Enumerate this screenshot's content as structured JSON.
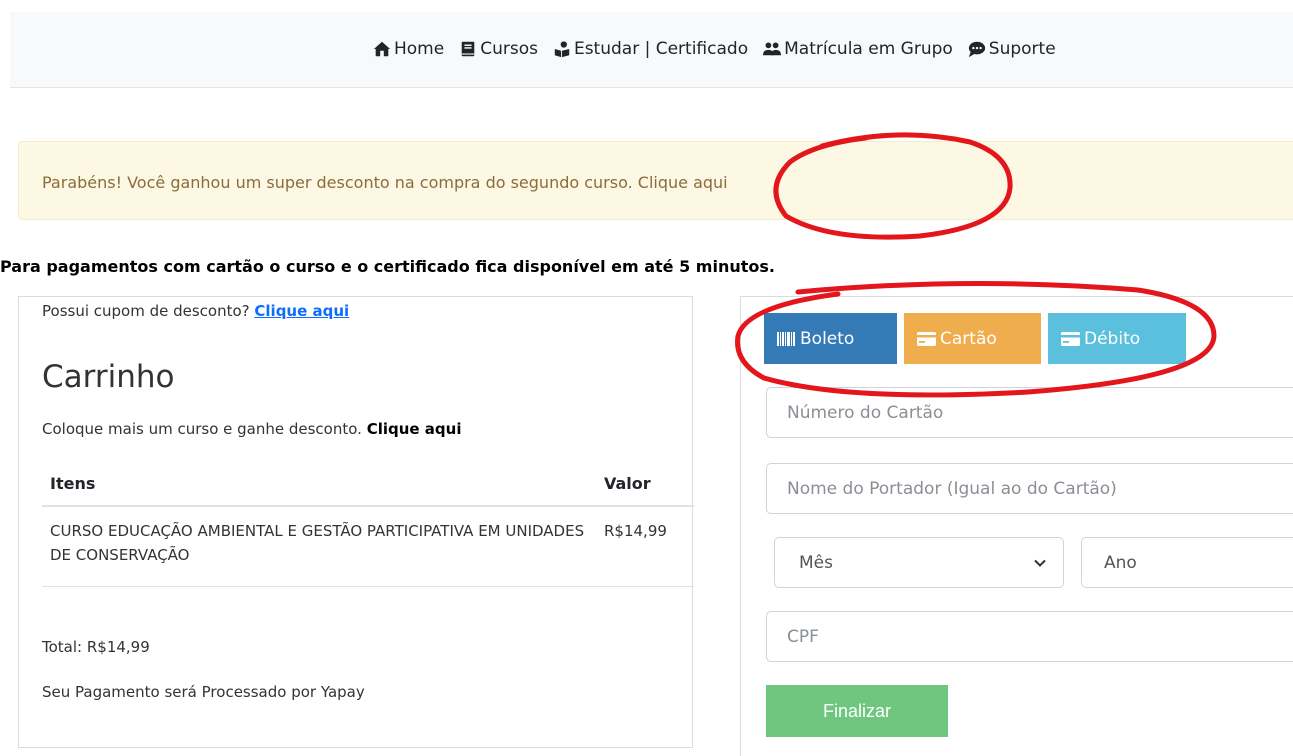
{
  "nav": {
    "items": [
      {
        "label": "Home",
        "icon": "home-icon"
      },
      {
        "label": "Cursos",
        "icon": "book-icon"
      },
      {
        "label": "Estudar | Certificado",
        "icon": "student-icon"
      },
      {
        "label": "Matrícula em Grupo",
        "icon": "group-icon"
      },
      {
        "label": "Suporte",
        "icon": "chat-icon"
      }
    ]
  },
  "alert": {
    "text": "Parabéns! Você ganhou um super desconto na compra do segundo curso. ",
    "link": "Clique aqui"
  },
  "note": "Para pagamentos com cartão o curso e o certificado fica disponível em até 5 minutos.",
  "cart": {
    "coupon_text": "Possui cupom de desconto? ",
    "coupon_link": "Clique aqui",
    "title": "Carrinho",
    "promo_text": "Coloque mais um curso e ganhe desconto. ",
    "promo_link": "Clique aqui",
    "columns": [
      "Itens",
      "Valor"
    ],
    "rows": [
      {
        "name": "CURSO EDUCAÇÃO AMBIENTAL E GESTÃO PARTICIPATIVA EM UNIDADES DE CONSERVAÇÃO",
        "price": "R$14,99"
      }
    ],
    "total": "Total: R$14,99",
    "processor": "Seu Pagamento será Processado por Yapay"
  },
  "payment": {
    "tabs": [
      {
        "label": "Boleto",
        "icon": "barcode-icon",
        "color": "#337ab7"
      },
      {
        "label": "Cartão",
        "icon": "credit-card-icon",
        "color": "#f0ad4e"
      },
      {
        "label": "Débito",
        "icon": "credit-card-icon",
        "color": "#5bc0de"
      }
    ],
    "card_number_placeholder": "Número do Cartão",
    "holder_placeholder": "Nome do Portador (Igual ao do Cartão)",
    "month_label": "Mês",
    "year_label": "Ano",
    "cpf_placeholder": "CPF",
    "submit_label": "Finalizar",
    "submit_color": "#6fc77f"
  },
  "annotation_color": "#e3161b"
}
